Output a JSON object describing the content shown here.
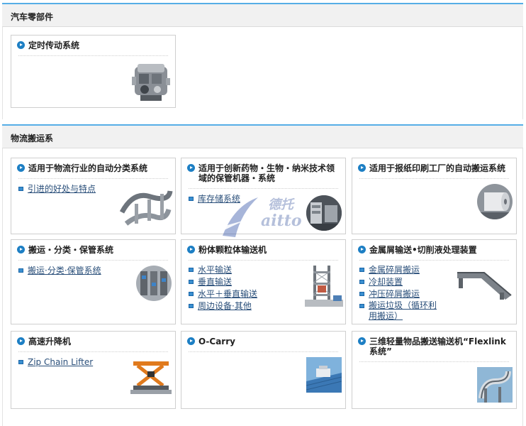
{
  "sections": {
    "auto_parts": {
      "title": "汽车零部件"
    },
    "logistics": {
      "title": "物流搬运系"
    }
  },
  "cards": {
    "timing": {
      "title": "定时传动系统"
    },
    "sorting": {
      "title": "适用于物流行业的自动分类系统",
      "links": [
        "引进的好处与特点"
      ]
    },
    "pharma": {
      "title": "适用于创新药物・生物・纳米技术领域的保管机器・系统",
      "links": [
        "库存储系统"
      ]
    },
    "newspaper": {
      "title": "适用于报纸印刷工厂的自动搬运系统"
    },
    "storage": {
      "title": "搬运・分类・保管系统",
      "links": [
        "搬运·分类·保管系统"
      ]
    },
    "powder": {
      "title": "粉体颗粒体输送机",
      "links": [
        "水平输送",
        "垂直输送",
        "水平＋垂直输送",
        "周边设备·其他"
      ]
    },
    "metal": {
      "title": "金属屑输送•切削液处理装置",
      "links": [
        "金属碎屑搬运",
        "冷却装置",
        "冲压碎屑搬运",
        "搬运垃圾（循环利用搬运）"
      ]
    },
    "lifter": {
      "title": "高速升降机",
      "links": [
        "Zip Chain Lifter"
      ]
    },
    "ocarry": {
      "title": "O-Carry"
    },
    "flexlink": {
      "title": "三维轻量物品搬送输送机“Flexlink系统”"
    }
  },
  "watermark": {
    "cn": "德托",
    "en": "aitto"
  },
  "colors": {
    "accent": "#56aee6",
    "bullet": "#1d7fc4",
    "link": "#2a4f7a"
  }
}
